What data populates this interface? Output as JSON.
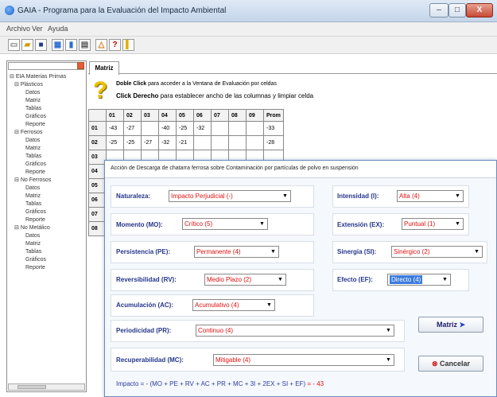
{
  "window": {
    "title": "GAIA - Programa para la Evaluación del Impacto Ambiental",
    "min": "–",
    "max": "□",
    "close": "X"
  },
  "menu": {
    "archivo": "Archivo",
    "ver": "Ver",
    "ayuda": "Ayuda"
  },
  "tree": {
    "root": "EIA Materias Primas",
    "groups": [
      {
        "label": "Plásticos",
        "items": [
          "Datos",
          "Matriz",
          "Tablas",
          "Gráficos",
          "Reporte"
        ]
      },
      {
        "label": "Ferrosos",
        "items": [
          "Datos",
          "Matriz",
          "Tablas",
          "Gráficos",
          "Reporte"
        ]
      },
      {
        "label": "No Ferrosos",
        "items": [
          "Datos",
          "Matriz",
          "Tablas",
          "Gráficos",
          "Reporte"
        ]
      },
      {
        "label": "No Metálico",
        "items": [
          "Datos",
          "Matriz",
          "Tablas",
          "Gráficos",
          "Reporte"
        ]
      }
    ]
  },
  "tab": {
    "label": "Matriz"
  },
  "info": {
    "line1_bold": "Doble Click",
    "line1_rest": " para acceder a la Ventana de Evaluación por celdas",
    "line2_bold": "Click Derecho",
    "line2_rest": " para establecer ancho de las columnas y limpiar celda"
  },
  "grid": {
    "headers": [
      "",
      "01",
      "02",
      "03",
      "04",
      "05",
      "06",
      "07",
      "08",
      "09",
      "Prom"
    ],
    "rows": [
      [
        "01",
        "-43",
        "-27",
        "",
        "-40",
        "-25",
        "-32",
        "",
        "",
        "",
        "-33"
      ],
      [
        "02",
        "-25",
        "-25",
        "-27",
        "-32",
        "-21",
        "",
        "",
        "",
        "",
        "-28"
      ],
      [
        "03",
        "",
        "",
        "",
        "",
        "",
        "",
        "",
        "",
        "",
        ""
      ],
      [
        "04",
        "",
        "",
        "",
        "",
        "",
        "",
        "",
        "",
        "",
        ""
      ],
      [
        "05",
        "",
        "",
        "",
        "",
        "",
        "",
        "",
        "",
        "",
        ""
      ],
      [
        "06",
        "",
        "",
        "",
        "",
        "",
        "",
        "",
        "",
        "",
        ""
      ],
      [
        "07",
        "",
        "",
        "",
        "",
        "",
        "",
        "",
        "",
        "",
        ""
      ],
      [
        "08",
        "",
        "",
        "",
        "",
        "",
        "",
        "",
        "",
        "",
        ""
      ]
    ]
  },
  "dialog": {
    "title": "Acción de Descarga de chatarra ferrosa sobre Contaminación por partículas de polvo en suspensión",
    "naturaleza": {
      "label": "Naturaleza:",
      "value": "Impacto Perjudicial (-)"
    },
    "intensidad": {
      "label": "Intensidad (I):",
      "value": "Alta (4)"
    },
    "momento": {
      "label": "Momento (MO):",
      "value": "Crítico (5)"
    },
    "extension": {
      "label": "Extensión (EX):",
      "value": "Puntual (1)"
    },
    "persistencia": {
      "label": "Persistencia (PE):",
      "value": "Permanente (4)"
    },
    "sinergia": {
      "label": "Sinergia (SI):",
      "value": "Sinérgico (2)"
    },
    "reversibilidad": {
      "label": "Reversibilidad (RV):",
      "value": "Medio Plazo (2)"
    },
    "efecto": {
      "label": "Efecto (EF):",
      "value": "Directo (4)"
    },
    "acumulacion": {
      "label": "Acumulación (AC):",
      "value": "Acumulativo (4)"
    },
    "periodicidad": {
      "label": "Periodicidad (PR):",
      "value": "Continuo (4)"
    },
    "recuperabilidad": {
      "label": "Recuperabilidad (MC):",
      "value": "Mitigable (4)"
    },
    "btn_matriz": "Matriz",
    "btn_cancelar": "Cancelar",
    "impacto_formula": "Impacto = - (MO + PE + RV + AC + PR + MC + 3I + 2EX + SI + EF)",
    "impacto_value": "= - 43"
  },
  "colors": {
    "label": "#24358a",
    "value": "#e01010",
    "highlight": "#3b7ae0"
  }
}
